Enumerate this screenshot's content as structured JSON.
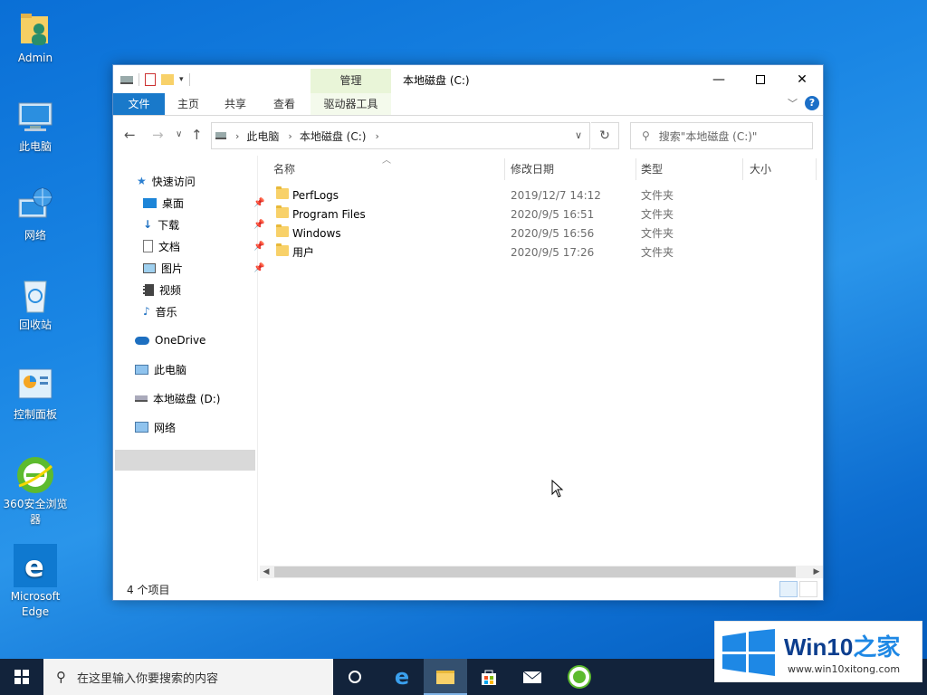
{
  "desktop": {
    "icons": [
      {
        "label": "Admin"
      },
      {
        "label": "此电脑"
      },
      {
        "label": "网络"
      },
      {
        "label": "回收站"
      },
      {
        "label": "控制面板"
      },
      {
        "label": "360安全浏览器"
      },
      {
        "label": "Microsoft Edge"
      }
    ]
  },
  "window": {
    "title": "本地磁盘 (C:)",
    "manage_tab": "管理",
    "ribbon_tabs": [
      "文件",
      "主页",
      "共享",
      "查看"
    ],
    "tool_tab": "驱动器工具",
    "address": {
      "crumbs": [
        "此电脑",
        "本地磁盘 (C:)"
      ]
    },
    "search_placeholder": "搜索\"本地磁盘 (C:)\"",
    "nav": {
      "quick_access": "快速访问",
      "items": [
        "桌面",
        "下载",
        "文档",
        "图片",
        "视频",
        "音乐"
      ],
      "onedrive": "OneDrive",
      "this_pc": "此电脑",
      "drive_d": "本地磁盘 (D:)",
      "network": "网络"
    },
    "columns": {
      "name": "名称",
      "date": "修改日期",
      "type": "类型",
      "size": "大小"
    },
    "files": [
      {
        "name": "PerfLogs",
        "date": "2019/12/7 14:12",
        "type": "文件夹"
      },
      {
        "name": "Program Files",
        "date": "2020/9/5 16:51",
        "type": "文件夹"
      },
      {
        "name": "Windows",
        "date": "2020/9/5 16:56",
        "type": "文件夹"
      },
      {
        "name": "用户",
        "date": "2020/9/5 17:26",
        "type": "文件夹"
      }
    ],
    "status": "4 个项目"
  },
  "taskbar": {
    "search_placeholder": "在这里输入你要搜索的内容"
  },
  "watermark": {
    "title_part1": "Win10",
    "title_part2": "之家",
    "url": "www.win10xitong.com"
  },
  "colors": {
    "accent": "#1979ca",
    "desktop": "#1a86e4",
    "taskbar": "#12233b"
  }
}
